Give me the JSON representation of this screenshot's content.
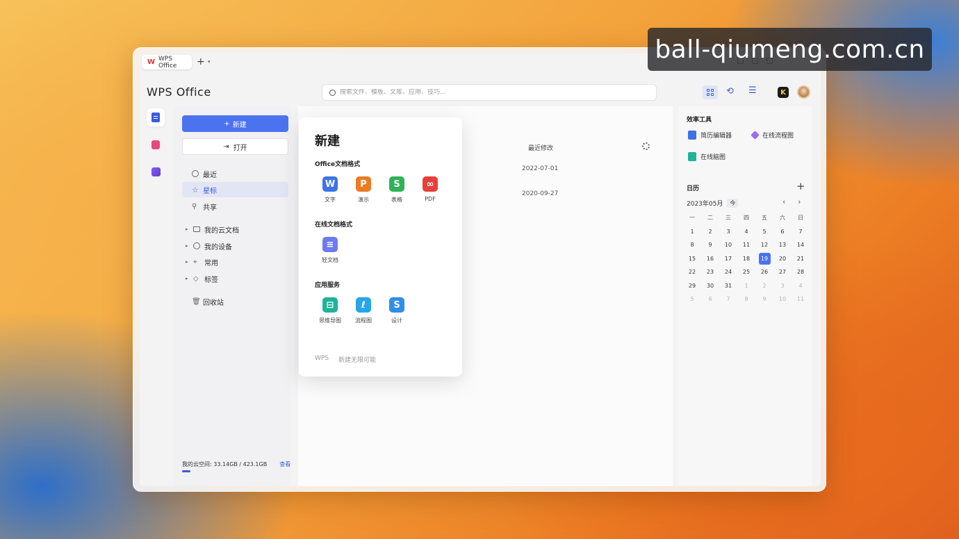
{
  "tab": {
    "label": "WPS Office",
    "logo": "W",
    "add": "+",
    "dropdown": "▾"
  },
  "app_title": "WPS Office",
  "search": {
    "placeholder": "搜索文件、模板、文库、应用、技巧..."
  },
  "header_icons": [
    "grid-view-icon",
    "sync-icon",
    "list-menu-icon",
    "k-badge-icon",
    "avatar"
  ],
  "header_badge": "K",
  "sidebar": {
    "new_button": "新建",
    "open_button": "打开",
    "quick": [
      {
        "label": "最近",
        "icon": "clock-icon"
      },
      {
        "label": "星标",
        "icon": "star-icon",
        "active": true
      },
      {
        "label": "共享",
        "icon": "share-icon"
      }
    ],
    "tree": [
      {
        "label": "我的云文档",
        "icon": "folder-icon"
      },
      {
        "label": "我的设备",
        "icon": "cloud-icon"
      },
      {
        "label": "常用",
        "icon": "pin-icon"
      },
      {
        "label": "标签",
        "icon": "tag-icon"
      }
    ],
    "trash": "回收站",
    "storage_text": "我的云空间: 33.14GB / 423.1GB",
    "storage_view": "查看",
    "storage_fraction": 0.078
  },
  "main": {
    "column_header": "最近修改",
    "dates": [
      "2022-07-01",
      "2020-09-27"
    ]
  },
  "popup": {
    "title": "新建",
    "section_office": "Office文档格式",
    "office_apps": [
      {
        "label": "文字",
        "glyph": "W",
        "color": "#3d73e6"
      },
      {
        "label": "演示",
        "glyph": "P",
        "color": "#ec7a22"
      },
      {
        "label": "表格",
        "glyph": "S",
        "color": "#2eb25a"
      },
      {
        "label": "PDF",
        "glyph": "∞",
        "color": "#e5403a"
      }
    ],
    "section_online": "在线文档格式",
    "online_apps": [
      {
        "label": "轻文档",
        "glyph": "≡",
        "color": "#6c7bf0"
      }
    ],
    "section_services": "应用服务",
    "service_apps": [
      {
        "label": "思维导图",
        "glyph": "⊟",
        "color": "#1fb39a"
      },
      {
        "label": "流程图",
        "glyph": "ℓ",
        "color": "#26a6e8"
      },
      {
        "label": "设计",
        "glyph": "S",
        "color": "#2f8ee8"
      }
    ],
    "footer_brand": "WPS",
    "footer_text": "新建无限可能"
  },
  "right": {
    "tools_title": "效率工具",
    "tools": [
      {
        "label": "简历编辑器",
        "icon": "resume-icon",
        "color": "#3d73e6"
      },
      {
        "label": "在线流程图",
        "icon": "flowchart-icon",
        "color": "#9b6cf0"
      },
      {
        "label": "在线脑图",
        "icon": "mindmap-icon",
        "color": "#1fb39a"
      }
    ],
    "calendar_title": "日历",
    "calendar_add": "+",
    "month": "2023年05月",
    "today_button": "今",
    "prev": "‹",
    "next": "›",
    "weekdays": [
      "一",
      "二",
      "三",
      "四",
      "五",
      "六",
      "日"
    ],
    "days": [
      [
        "1",
        "2",
        "3",
        "4",
        "5",
        "6",
        "7"
      ],
      [
        "8",
        "9",
        "10",
        "11",
        "12",
        "13",
        "14"
      ],
      [
        "15",
        "16",
        "17",
        "18",
        "19",
        "20",
        "21"
      ],
      [
        "22",
        "23",
        "24",
        "25",
        "26",
        "27",
        "28"
      ],
      [
        "29",
        "30",
        "31",
        "1",
        "2",
        "3",
        "4"
      ],
      [
        "5",
        "6",
        "7",
        "8",
        "9",
        "10",
        "11"
      ]
    ],
    "current_month_last_index": 30,
    "today": "19"
  },
  "watermark": "ball-qiumeng.com.cn"
}
